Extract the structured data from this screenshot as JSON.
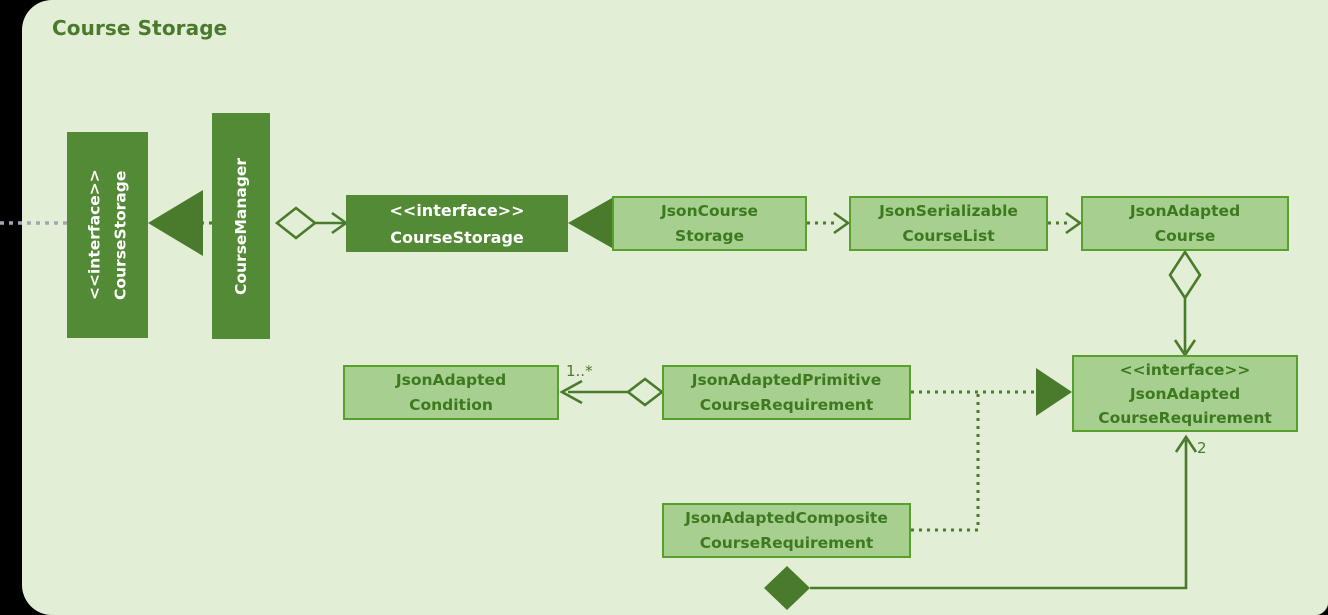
{
  "diagram": {
    "title": "Course Storage",
    "type": "uml-class-diagram",
    "colors": {
      "panel_background": "#e3eed7",
      "outside_background": "#000000",
      "light_node_fill": "#a7cf8f",
      "light_node_border": "#57a02c",
      "dark_node_fill": "#538a35",
      "text_green": "#3d7a1f",
      "title_green": "#4a7a2b",
      "edge_green": "#4a7a2b",
      "external_arrow_gray": "#aaa4b0"
    },
    "nodes": [
      {
        "id": "course-storage-interface",
        "style": "dark",
        "orientation": "vertical",
        "line1": "<<interface>>",
        "line2": "CourseStorage"
      },
      {
        "id": "course-manager",
        "style": "dark",
        "orientation": "vertical",
        "line1": "CourseManager",
        "line2": ""
      },
      {
        "id": "course-storage-interface-h",
        "style": "dark",
        "orientation": "horizontal",
        "line1": "<<interface>>",
        "line2": "CourseStorage"
      },
      {
        "id": "json-course-storage",
        "style": "light",
        "orientation": "horizontal",
        "line1": "JsonCourse",
        "line2": "Storage"
      },
      {
        "id": "json-serializable-course-list",
        "style": "light",
        "orientation": "horizontal",
        "line1": "JsonSerializable",
        "line2": "CourseList"
      },
      {
        "id": "json-adapted-course",
        "style": "light",
        "orientation": "horizontal",
        "line1": "JsonAdapted",
        "line2": "Course"
      },
      {
        "id": "json-adapted-condition",
        "style": "light",
        "orientation": "horizontal",
        "line1": "JsonAdapted",
        "line2": "Condition"
      },
      {
        "id": "json-adapted-primitive-course-requirement",
        "style": "light",
        "orientation": "horizontal",
        "line1": "JsonAdaptedPrimitive",
        "line2": "CourseRequirement"
      },
      {
        "id": "json-adapted-course-requirement-interface",
        "style": "light",
        "orientation": "horizontal",
        "line1": "<<interface>>",
        "line2": "JsonAdapted",
        "line3": "CourseRequirement"
      },
      {
        "id": "json-adapted-composite-course-requirement",
        "style": "light",
        "orientation": "horizontal",
        "line1": "JsonAdaptedComposite",
        "line2": "CourseRequirement"
      }
    ],
    "labels": {
      "condition_multiplicity": "1..*",
      "requirement_multiplicity": "2"
    }
  }
}
